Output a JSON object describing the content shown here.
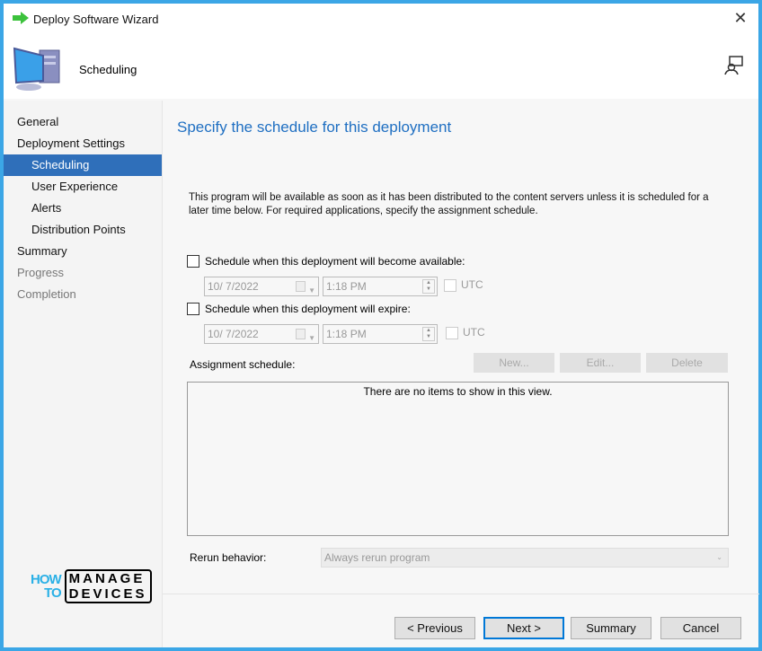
{
  "window": {
    "title": "Deploy Software Wizard",
    "close": "✕"
  },
  "header": {
    "title": "Scheduling"
  },
  "nav": [
    {
      "label": "General",
      "level": 0,
      "state": "normal"
    },
    {
      "label": "Deployment Settings",
      "level": 0,
      "state": "normal"
    },
    {
      "label": "Scheduling",
      "level": 1,
      "state": "selected"
    },
    {
      "label": "User Experience",
      "level": 1,
      "state": "normal"
    },
    {
      "label": "Alerts",
      "level": 1,
      "state": "normal"
    },
    {
      "label": "Distribution Points",
      "level": 1,
      "state": "normal"
    },
    {
      "label": "Summary",
      "level": 0,
      "state": "normal"
    },
    {
      "label": "Progress",
      "level": 0,
      "state": "disabled"
    },
    {
      "label": "Completion",
      "level": 0,
      "state": "disabled"
    }
  ],
  "main": {
    "heading": "Specify the schedule for this deployment",
    "description": "This program will be available as soon as it has been distributed to the content servers unless it is scheduled for a later time below. For required applications, specify the assignment schedule.",
    "available": {
      "label": "Schedule when this deployment will become available:",
      "date": "10/  7/2022",
      "time": "1:18 PM",
      "utc": "UTC"
    },
    "expire": {
      "label": "Schedule when this deployment will expire:",
      "date": "10/  7/2022",
      "time": "1:18 PM",
      "utc": "UTC"
    },
    "assignment_label": "Assignment schedule:",
    "buttons": {
      "new": "New...",
      "edit": "Edit...",
      "delete": "Delete"
    },
    "empty_list": "There are no items to show in this view.",
    "rerun_label": "Rerun behavior:",
    "rerun_value": "Always rerun program"
  },
  "footer": {
    "previous": "< Previous",
    "next": "Next >",
    "summary": "Summary",
    "cancel": "Cancel"
  },
  "logo": {
    "how": "HOW",
    "to": "TO",
    "manage": "MANAGE",
    "devices": "DEVICES"
  }
}
